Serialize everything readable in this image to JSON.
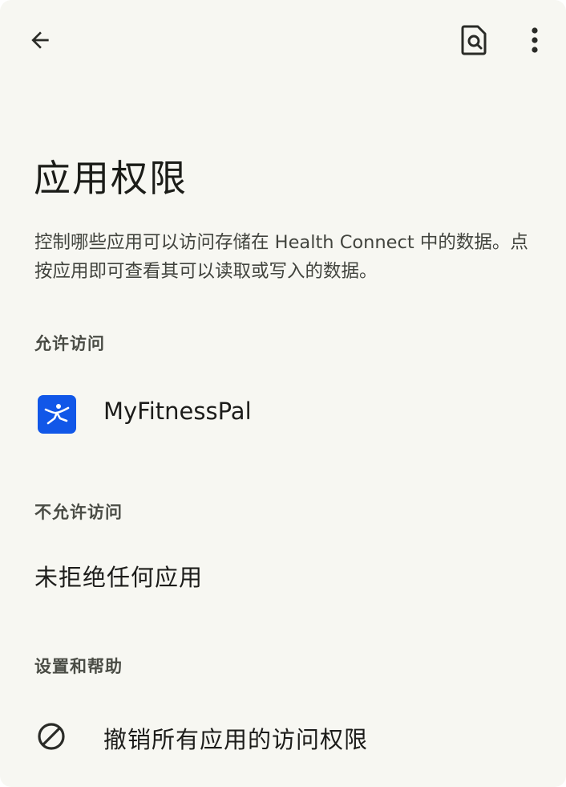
{
  "toolbar": {
    "back_icon": "arrow-back-icon",
    "search_icon": "document-search-icon",
    "more_icon": "more-vert-icon"
  },
  "page": {
    "title": "应用权限",
    "description": "控制哪些应用可以访问存储在 Health Connect 中的数据。点按应用即可查看其可以读取或写入的数据。"
  },
  "allowed": {
    "header": "允许访问",
    "apps": [
      {
        "name": "MyFitnessPal",
        "icon": "myfitnesspal-app-icon",
        "icon_color": "#1157e8"
      }
    ]
  },
  "denied": {
    "header": "不允许访问",
    "empty_text": "未拒绝任何应用"
  },
  "settings": {
    "header": "设置和帮助",
    "revoke_label": "撤销所有应用的访问权限",
    "revoke_icon": "block-icon"
  },
  "colors": {
    "background": "#f7f7f2",
    "text_primary": "#1c1c1a",
    "text_secondary": "#42443e",
    "brand_blue": "#1157e8"
  }
}
